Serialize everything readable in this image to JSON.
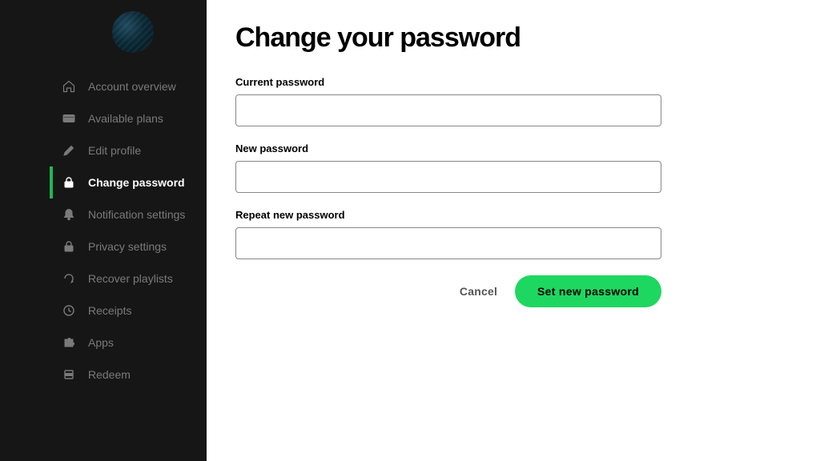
{
  "sidebar": {
    "items": [
      {
        "label": "Account overview",
        "icon": "home-icon",
        "active": false
      },
      {
        "label": "Available plans",
        "icon": "card-icon",
        "active": false
      },
      {
        "label": "Edit profile",
        "icon": "pencil-icon",
        "active": false
      },
      {
        "label": "Change password",
        "icon": "lock-icon",
        "active": true
      },
      {
        "label": "Notification settings",
        "icon": "bell-icon",
        "active": false
      },
      {
        "label": "Privacy settings",
        "icon": "lock-icon",
        "active": false
      },
      {
        "label": "Recover playlists",
        "icon": "refresh-icon",
        "active": false
      },
      {
        "label": "Receipts",
        "icon": "clock-icon",
        "active": false
      },
      {
        "label": "Apps",
        "icon": "puzzle-icon",
        "active": false
      },
      {
        "label": "Redeem",
        "icon": "redeem-icon",
        "active": false
      }
    ]
  },
  "main": {
    "title": "Change your password",
    "fields": {
      "current": {
        "label": "Current password",
        "value": ""
      },
      "new": {
        "label": "New password",
        "value": ""
      },
      "repeat": {
        "label": "Repeat new password",
        "value": ""
      }
    },
    "actions": {
      "cancel": "Cancel",
      "submit": "Set new password"
    }
  },
  "colors": {
    "accent": "#1ED760",
    "sidebar_bg": "#161616"
  }
}
